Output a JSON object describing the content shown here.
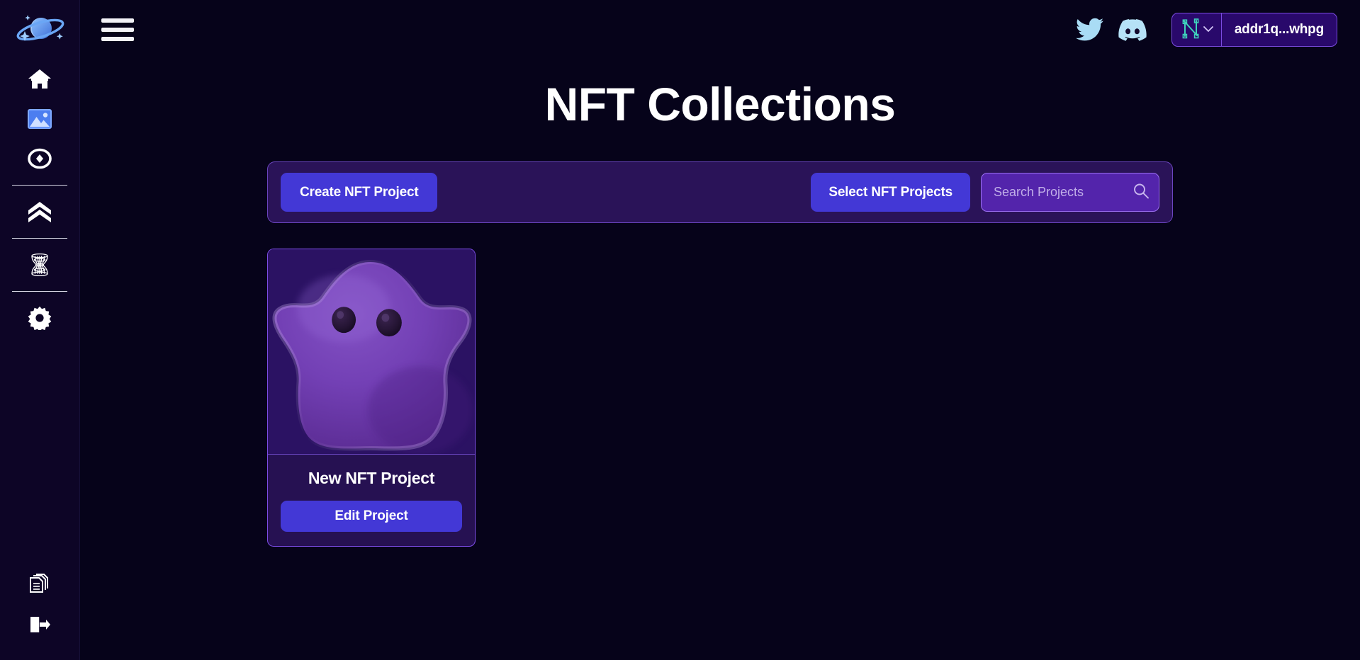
{
  "app": {
    "logo_name": "saturn-planet-logo",
    "background": "#06031a",
    "accent": "#4338d6",
    "panel": "#2a1358",
    "card_border": "#7d4de8"
  },
  "sidebar": {
    "items": [
      {
        "icon": "home-icon",
        "label": "Home",
        "active": false
      },
      {
        "icon": "image-icon",
        "label": "Images",
        "active": true
      },
      {
        "icon": "eye-token-icon",
        "label": "Tokens",
        "active": false
      },
      {
        "icon": "double-chevron-up-icon",
        "label": "Upload",
        "active": false
      },
      {
        "icon": "wormhole-icon",
        "label": "Wormhole",
        "active": false
      },
      {
        "icon": "gear-icon",
        "label": "Settings",
        "active": false
      }
    ],
    "bottom_items": [
      {
        "icon": "documents-icon",
        "label": "Documents"
      },
      {
        "icon": "logout-icon",
        "label": "Log out"
      }
    ]
  },
  "topbar": {
    "menu_icon": "hamburger-menu-icon",
    "twitter_icon": "twitter-icon",
    "discord_icon": "discord-icon",
    "wallet": {
      "icon": "nami-wallet-icon",
      "chevron": "chevron-down-icon",
      "address": "addr1q...whpg"
    }
  },
  "main": {
    "title": "NFT Collections",
    "toolbar": {
      "create_label": "Create NFT Project",
      "select_label": "Select NFT Projects",
      "search_placeholder": "Search Projects",
      "search_value": "",
      "search_icon": "search-icon"
    },
    "projects": [
      {
        "name": "New NFT Project",
        "edit_label": "Edit Project",
        "thumbnail": "purple-blob-character"
      }
    ]
  }
}
